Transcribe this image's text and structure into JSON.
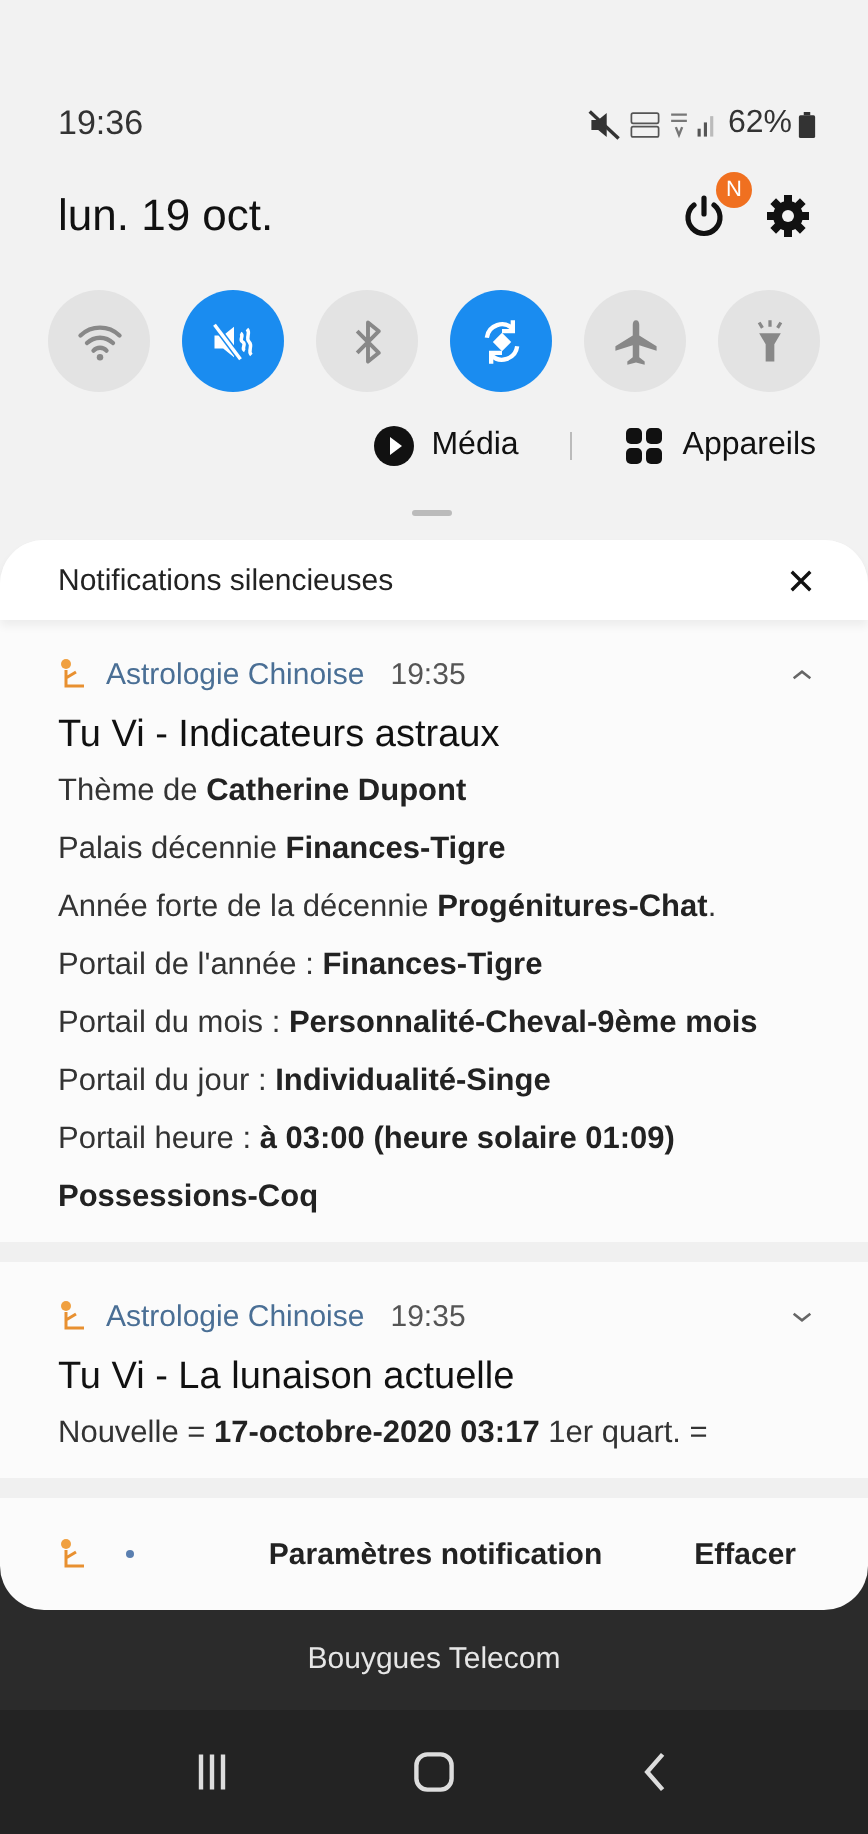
{
  "status_bar": {
    "time": "19:36",
    "battery": "62%"
  },
  "header": {
    "date": "lun. 19 oct.",
    "power_badge": "N"
  },
  "quick_toggles": [
    {
      "kind": "wifi",
      "on": false
    },
    {
      "kind": "mute",
      "on": true
    },
    {
      "kind": "bluetooth",
      "on": false
    },
    {
      "kind": "rotate",
      "on": true
    },
    {
      "kind": "airplane",
      "on": false
    },
    {
      "kind": "flashlight",
      "on": false
    }
  ],
  "media_buttons": [
    {
      "kind": "media",
      "label": "Média"
    },
    {
      "kind": "devices",
      "label": "Appareils"
    }
  ],
  "notification_panel": {
    "section_title": "Notifications silencieuses",
    "notifications": [
      {
        "app": "Astrologie Chinoise",
        "time": "19:35",
        "expanded": true,
        "title": "Tu Vi - Indicateurs astraux",
        "lines": [
          "Thème de **Catherine Dupont**",
          "Palais décennie **Finances-Tigre**",
          "Année forte de la décennie **Progénitures-Chat**.",
          "Portail de l'année : **Finances-Tigre**",
          "Portail du mois : **Personnalité-Cheval-9ème mois**",
          "Portail du jour : **Individualité-Singe**",
          "Portail heure : **à 03:00 (heure solaire 01:09) Possessions-Coq**"
        ]
      },
      {
        "app": "Astrologie Chinoise",
        "time": "19:35",
        "expanded": false,
        "title": "Tu Vi - La lunaison actuelle",
        "lines": [
          "Nouvelle = **17-octobre-2020 03:17** 1er quart. ="
        ]
      }
    ],
    "footer_buttons": [
      "Paramètres notification",
      "Effacer"
    ]
  },
  "carrier": "Bouygues Telecom"
}
